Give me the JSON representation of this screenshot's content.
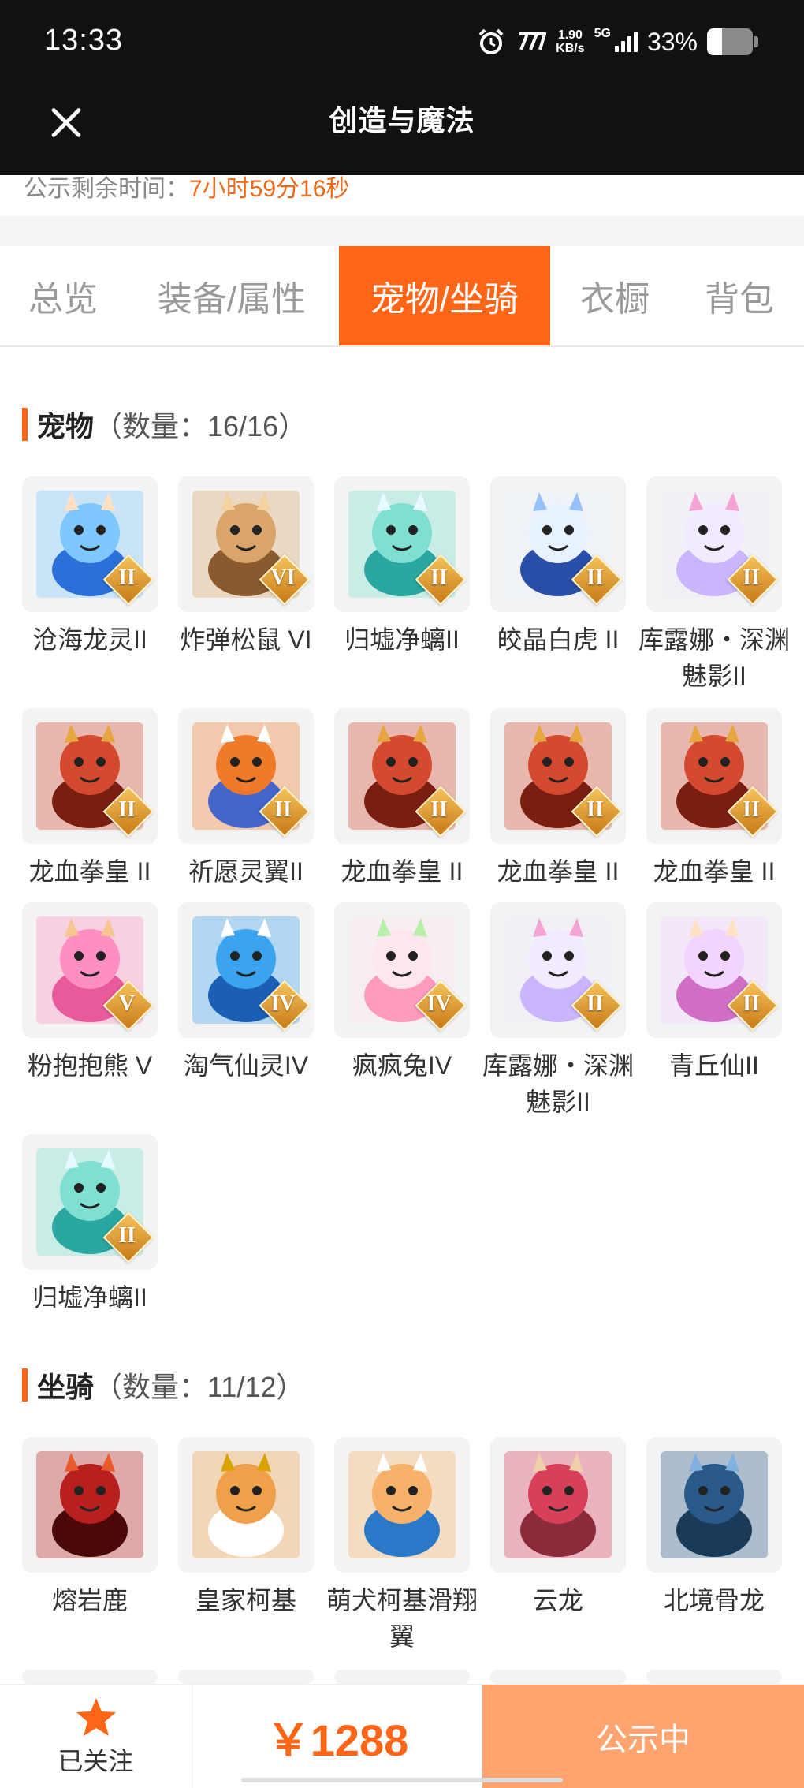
{
  "status_bar": {
    "time": "13:33",
    "net_speed_value": "1.90",
    "net_speed_unit": "KB/s",
    "network": "5G",
    "battery": "33%",
    "battery_level": 0.33
  },
  "header": {
    "title": "创造与魔法",
    "close_icon": "close-icon"
  },
  "countdown": {
    "label": "公示剩余时间：",
    "value": "7小时59分16秒"
  },
  "tabs": [
    {
      "label": "总览",
      "active": false
    },
    {
      "label": "装备/属性",
      "active": false
    },
    {
      "label": "宠物/坐骑",
      "active": true
    },
    {
      "label": "衣橱",
      "active": false
    },
    {
      "label": "背包",
      "active": false
    }
  ],
  "pets": {
    "title": "宠物",
    "count": "（数量：16/16）",
    "items": [
      {
        "name": "沧海龙灵II",
        "rank": "II"
      },
      {
        "name": "炸弹松鼠 VI",
        "rank": "VI"
      },
      {
        "name": "归墟净螭II",
        "rank": "II"
      },
      {
        "name": "皎晶白虎 II",
        "rank": "II"
      },
      {
        "name": "库露娜・深渊魅影II",
        "rank": "II"
      },
      {
        "name": "龙血拳皇 II",
        "rank": "II"
      },
      {
        "name": "祈愿灵翼II",
        "rank": "II"
      },
      {
        "name": "龙血拳皇 II",
        "rank": "II"
      },
      {
        "name": "龙血拳皇 II",
        "rank": "II"
      },
      {
        "name": "龙血拳皇 II",
        "rank": "II"
      },
      {
        "name": "粉抱抱熊 V",
        "rank": "V"
      },
      {
        "name": "淘气仙灵IV",
        "rank": "IV"
      },
      {
        "name": "疯疯兔IV",
        "rank": "IV"
      },
      {
        "name": "库露娜・深渊魅影II",
        "rank": "II"
      },
      {
        "name": "青丘仙II",
        "rank": "II"
      },
      {
        "name": "归墟净螭II",
        "rank": "II"
      }
    ]
  },
  "mounts": {
    "title": "坐骑",
    "count": "（数量：11/12）",
    "items": [
      {
        "name": "熔岩鹿"
      },
      {
        "name": "皇家柯基"
      },
      {
        "name": "萌犬柯基滑翔翼"
      },
      {
        "name": "云龙"
      },
      {
        "name": "北境骨龙"
      }
    ]
  },
  "bottom_bar": {
    "follow_label": "已关注",
    "price": "￥1288",
    "action_label": "公示中"
  },
  "colors": {
    "accent": "#ff6517",
    "countdown": "#ee6a1a",
    "action_button": "#ffa46e"
  }
}
